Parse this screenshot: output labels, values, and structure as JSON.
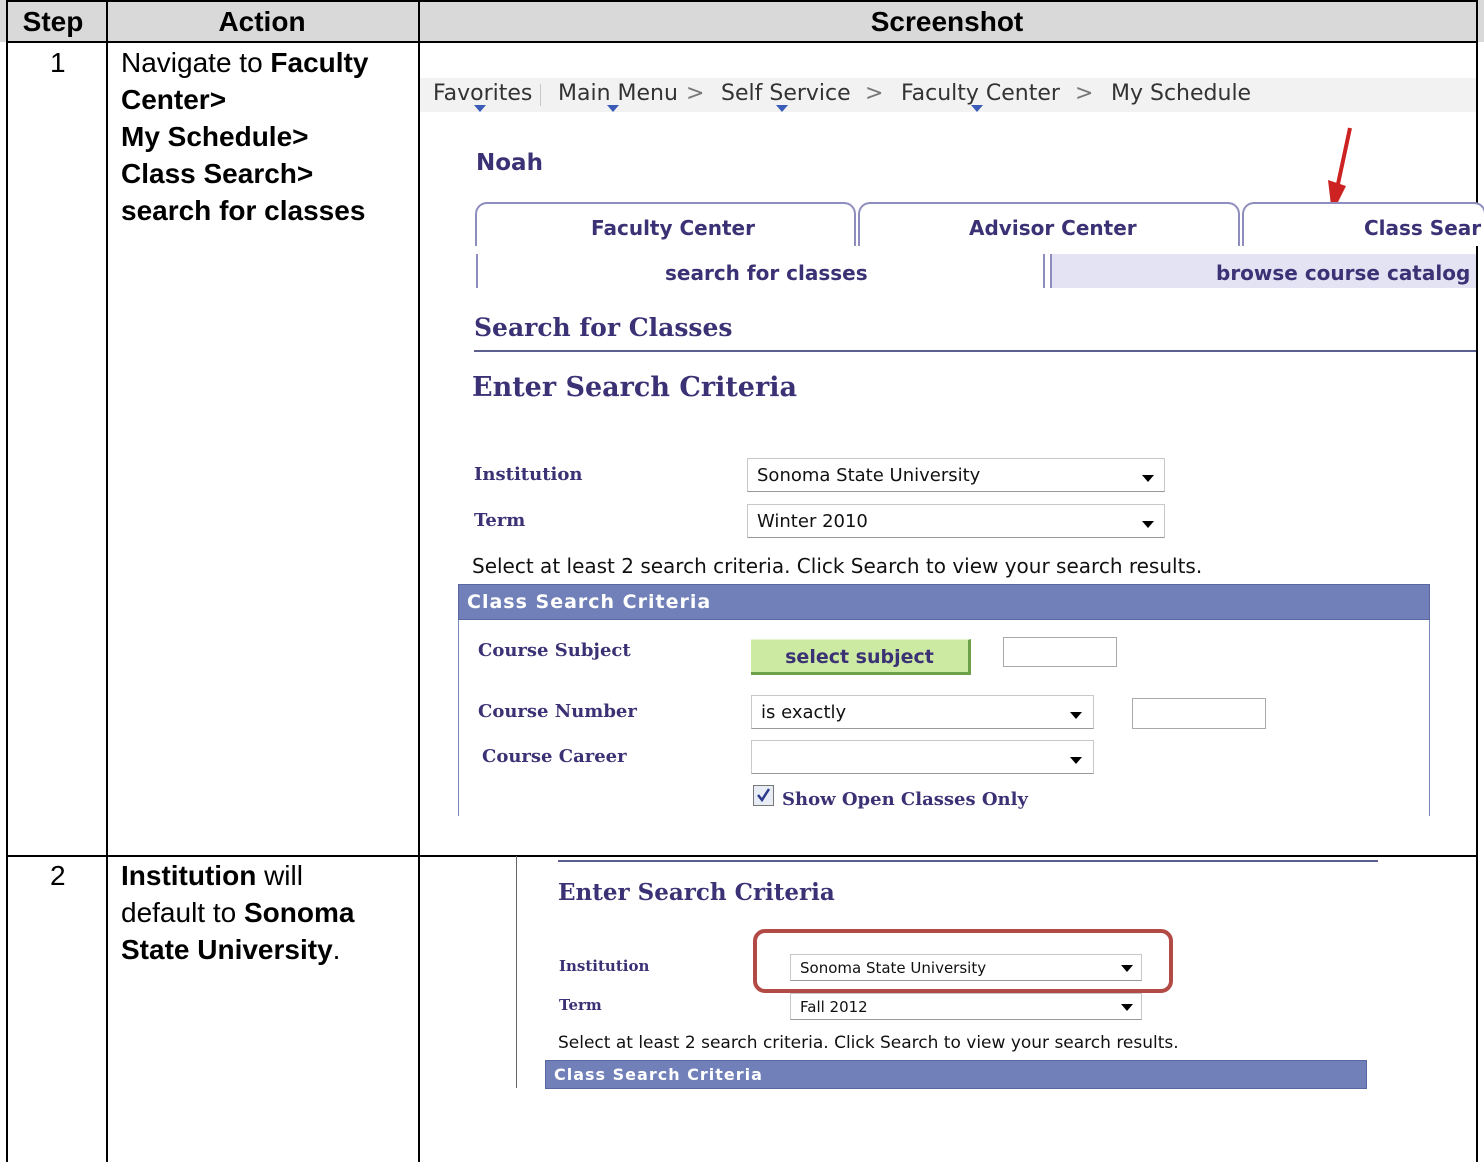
{
  "table": {
    "headers": {
      "step": "Step",
      "action": "Action",
      "screenshot": "Screenshot"
    },
    "rows": [
      {
        "step": "1",
        "action": {
          "prefix": "Navigate to ",
          "bold_lines": [
            "Faculty",
            "Center>",
            "My Schedule>",
            "Class Search>",
            "search for classes"
          ]
        }
      },
      {
        "step": "2",
        "action": {
          "b1": "Institution",
          "t1": " will",
          "t2": "default to ",
          "b2": "Sonoma",
          "b3": "State University",
          "t3": "."
        }
      }
    ]
  },
  "screenshot1": {
    "breadcrumb": {
      "items": [
        "Favorites",
        "Main Menu",
        "Self Service",
        "Faculty Center",
        "My Schedule"
      ],
      "separator": ">"
    },
    "user_name": "Noah",
    "tabs": [
      "Faculty Center",
      "Advisor Center",
      "Class Sear"
    ],
    "subtabs": [
      "search for classes",
      "browse course catalog"
    ],
    "page_title": "Search for Classes",
    "section_title": "Enter Search Criteria",
    "fields": {
      "institution": {
        "label": "Institution",
        "value": "Sonoma State University"
      },
      "term": {
        "label": "Term",
        "value": "Winter 2010"
      }
    },
    "instruction": "Select at least 2 search criteria. Click Search to view your search results.",
    "criteria_header": "Class Search Criteria",
    "course_subject": {
      "label": "Course Subject",
      "button": "select subject",
      "value": ""
    },
    "course_number": {
      "label": "Course Number",
      "operator": "is exactly",
      "value": ""
    },
    "course_career": {
      "label": "Course Career",
      "value": ""
    },
    "open_only": {
      "label": "Show Open Classes Only",
      "checked": true
    }
  },
  "screenshot2": {
    "section_title": "Enter Search Criteria",
    "fields": {
      "institution": {
        "label": "Institution",
        "value": "Sonoma State University"
      },
      "term": {
        "label": "Term",
        "value": "Fall 2012"
      }
    },
    "instruction": "Select at least 2 search criteria. Click Search to view your search results.",
    "criteria_header": "Class Search Criteria"
  },
  "colors": {
    "accent": "#3b3275",
    "header_bar": "#7180b8",
    "highlight": "#b24a45",
    "arrow": "#cc2222",
    "button": "#cdeaa2"
  }
}
